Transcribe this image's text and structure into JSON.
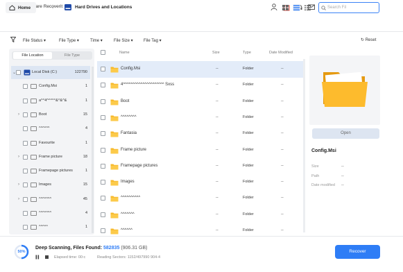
{
  "app": {
    "title": "Wondershare Recoverit"
  },
  "nav": {
    "home_label": "Home",
    "location_title": "Hard Drives and Locations",
    "search_placeholder": "Search Fil"
  },
  "filters": {
    "items": [
      "File Status",
      "File Type",
      "Time",
      "File Size",
      "File Tag"
    ],
    "reset_label": "Reset"
  },
  "left_tabs": {
    "file_location": "File Location",
    "file_type": "File Type"
  },
  "tree": [
    {
      "label": "Local Disk (C:)",
      "count": "122790",
      "level": 0,
      "expand": "",
      "icon": "drive"
    },
    {
      "label": "Config.Msi",
      "count": "1",
      "level": 1,
      "expand": "",
      "icon": "folder"
    },
    {
      "label": "a^^4^^^^^&^&^&",
      "count": "1",
      "level": 1,
      "expand": "",
      "icon": "folder"
    },
    {
      "label": "Boot",
      "count": "15",
      "level": 1,
      "expand": ">",
      "icon": "folder"
    },
    {
      "label": "^^^^^^",
      "count": "4",
      "level": 1,
      "expand": "",
      "icon": "folder"
    },
    {
      "label": "Favourite",
      "count": "1",
      "level": 1,
      "expand": "",
      "icon": "folder"
    },
    {
      "label": "Frame picture",
      "count": "18",
      "level": 1,
      "expand": ">",
      "icon": "folder"
    },
    {
      "label": "Framepage pictures",
      "count": "1",
      "level": 1,
      "expand": "",
      "icon": "folder"
    },
    {
      "label": "Images",
      "count": "15",
      "level": 1,
      "expand": ">",
      "icon": "folder"
    },
    {
      "label": "^^^^^^^",
      "count": "45",
      "level": 1,
      "expand": ">",
      "icon": "folder"
    },
    {
      "label": "^^^^^^^",
      "count": "4",
      "level": 1,
      "expand": "",
      "icon": "folder"
    },
    {
      "label": "^^^^^",
      "count": "1",
      "level": 1,
      "expand": "",
      "icon": "folder"
    }
  ],
  "columns": {
    "name": "Name",
    "size": "Size",
    "type": "Type",
    "date": "Date Modified"
  },
  "files": [
    {
      "name": "Config.Msi",
      "size": "--",
      "type": "Folder",
      "date": "--"
    },
    {
      "name": "4^^^^^^^^^^^^^^^^^^^^^ Sxss",
      "size": "--",
      "type": "Folder",
      "date": "--"
    },
    {
      "name": "Boot",
      "size": "--",
      "type": "Folder",
      "date": "--"
    },
    {
      "name": "^^^^^^^^",
      "size": "--",
      "type": "Folder",
      "date": "--"
    },
    {
      "name": "Fantasia",
      "size": "--",
      "type": "Folder",
      "date": "--"
    },
    {
      "name": "Frame picture",
      "size": "--",
      "type": "Folder",
      "date": "--"
    },
    {
      "name": "Framepage pictures",
      "size": "--",
      "type": "Folder",
      "date": "--"
    },
    {
      "name": "Images",
      "size": "--",
      "type": "Folder",
      "date": "--"
    },
    {
      "name": "^^^^^^^^^^",
      "size": "--",
      "type": "Folder",
      "date": "--"
    },
    {
      "name": "^^^^^^^",
      "size": "--",
      "type": "Folder",
      "date": "--"
    },
    {
      "name": "^^^^^^",
      "size": "--",
      "type": "Folder",
      "date": "--"
    }
  ],
  "preview": {
    "button_label": "Open",
    "title": "Config.Msi",
    "fields": [
      {
        "label": "Size",
        "value": "--"
      },
      {
        "label": "Path",
        "value": "--"
      },
      {
        "label": "Date modified",
        "value": "--"
      }
    ]
  },
  "scan": {
    "progress": "50%",
    "title_prefix": "Deep Scanning, Files Found: ",
    "files_found": "582835",
    "size": " (906.31 GB)",
    "elapsed": "Elapsed time: 00:c",
    "reading": "Reading Sectors: 1152/497990 904-4",
    "recover_label": "Recover"
  },
  "colors": {
    "accent": "#2e7df6",
    "folder": "#f7b92b"
  }
}
